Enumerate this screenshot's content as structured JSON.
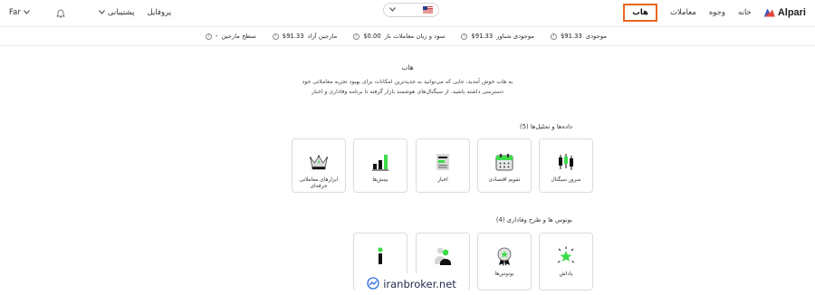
{
  "header": {
    "language": "Far",
    "support": "پشتیبانی",
    "profile": "پروفایل",
    "tabs": [
      {
        "label": "هاب",
        "active": true
      },
      {
        "label": "معاملات"
      },
      {
        "label": "وجوه"
      },
      {
        "label": "خانه"
      }
    ],
    "logo_text": "Alpari",
    "accent_color": "#e8671e"
  },
  "account_bar": [
    {
      "label": "موجودی",
      "value": "$91.33"
    },
    {
      "label": "موجودی شناور",
      "value": "$91.33"
    },
    {
      "label": "سود و زیان معاملات باز",
      "value": "$0.00"
    },
    {
      "label": "مارجین آزاد",
      "value": "$91.33"
    },
    {
      "label": "سطح مارجین",
      "value": "-"
    }
  ],
  "hub": {
    "title": "هاب",
    "description_1": "به هاب خوش آمدید، جایی که می‌توانید به جدیدترین امکانات برای بهبود تجربه معاملاتی خود",
    "description_2": "دسترسی داشته باشید. از سیگنال‌های هوشمند بازار گرفته تا برنامه وفاداری و اخبار"
  },
  "section_analysis": {
    "title": "داده‌ها و تحلیل‌ها (5)",
    "cards": [
      {
        "label": "سرور سیگنال",
        "icon": "candlestick-icon"
      },
      {
        "label": "تقویم اقتصادی",
        "icon": "calendar-icon"
      },
      {
        "label": "اخبار",
        "icon": "news-icon"
      },
      {
        "label": "بینش‌ها",
        "icon": "bar-chart-icon"
      },
      {
        "label": "ابزارهای معاملاتی حرفه‌ای",
        "icon": "crown-icon"
      }
    ]
  },
  "section_bonus": {
    "title": "بونوس ها و طرح وفاداری (4)",
    "cards": [
      {
        "label": "پاداش",
        "icon": "star-sparkle-icon"
      },
      {
        "label": "بونوس‌ها",
        "icon": "medal-icon"
      },
      {
        "label": "",
        "icon": "people-icon"
      },
      {
        "label": "",
        "icon": "info-figure-icon"
      }
    ]
  },
  "watermark": "iranbroker.net",
  "green": "#3ddc4a"
}
